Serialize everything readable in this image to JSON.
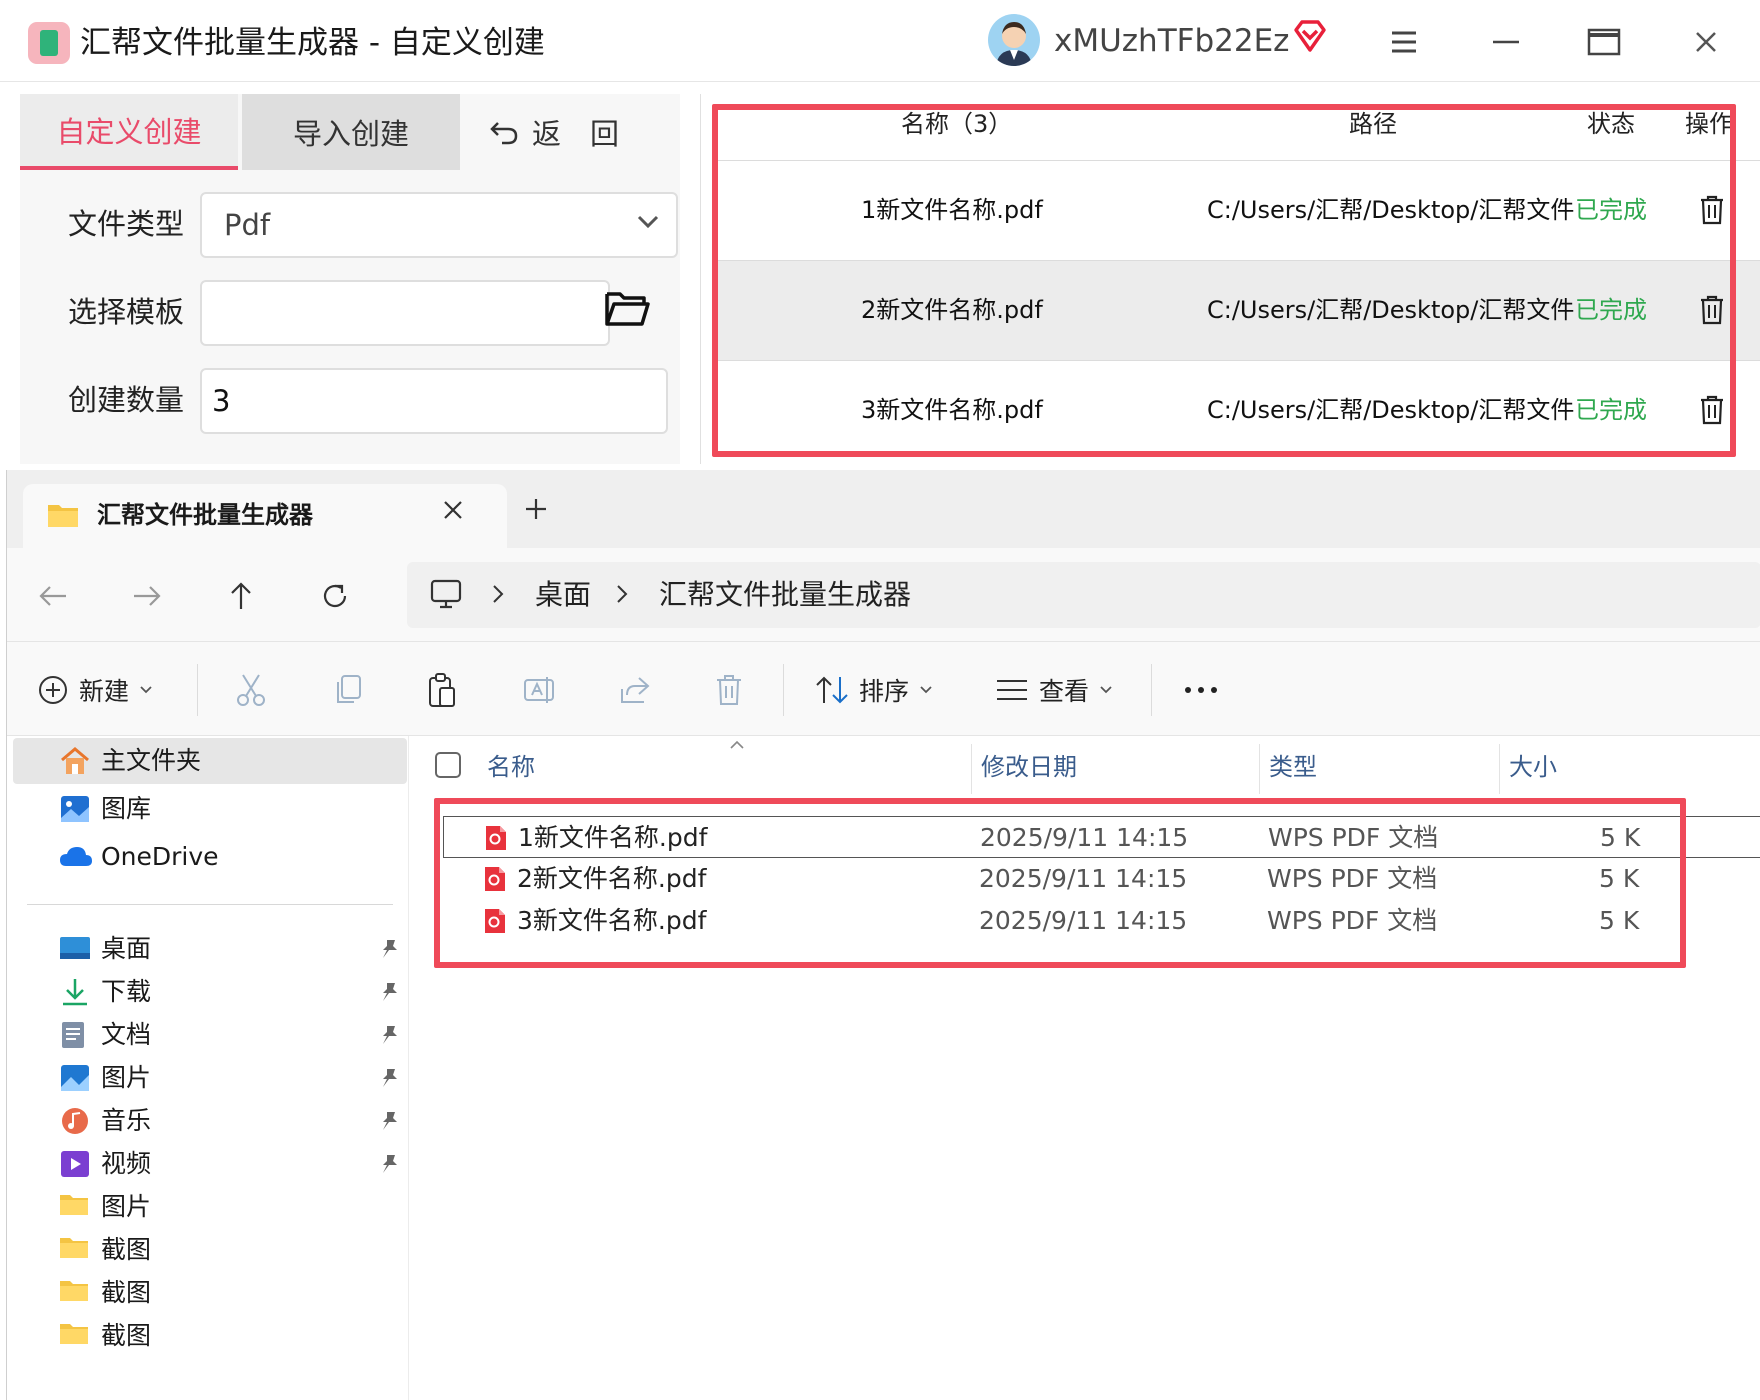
{
  "app": {
    "title": "汇帮文件批量生成器 - 自定义创建",
    "username": "xMUzhTFb22Ez"
  },
  "form": {
    "tabs": [
      "自定义创建",
      "导入创建"
    ],
    "back_label": "返　回",
    "file_type_label": "文件类型",
    "file_type_value": "Pdf",
    "template_label": "选择模板",
    "template_value": "",
    "count_label": "创建数量",
    "count_value": "3"
  },
  "results": {
    "headers": {
      "name": "名称（3）",
      "path": "路径",
      "status": "状态",
      "action": "操作"
    },
    "rows": [
      {
        "name": "1新文件名称.pdf",
        "path": "C:/Users/汇帮/Desktop/汇帮文件",
        "status": "已完成"
      },
      {
        "name": "2新文件名称.pdf",
        "path": "C:/Users/汇帮/Desktop/汇帮文件",
        "status": "已完成"
      },
      {
        "name": "3新文件名称.pdf",
        "path": "C:/Users/汇帮/Desktop/汇帮文件",
        "status": "已完成"
      }
    ]
  },
  "explorer": {
    "tab_title": "汇帮文件批量生成器",
    "breadcrumb": [
      "桌面",
      "汇帮文件批量生成器"
    ],
    "toolbar": {
      "new": "新建",
      "sort": "排序",
      "view": "查看"
    },
    "sidebar": {
      "top": [
        "主文件夹",
        "图库",
        "OneDrive"
      ],
      "pinned": [
        "桌面",
        "下载",
        "文档",
        "图片",
        "音乐",
        "视频"
      ],
      "folders": [
        "图片",
        "截图",
        "截图",
        "截图"
      ]
    },
    "columns": {
      "name": "名称",
      "modified": "修改日期",
      "type": "类型",
      "size": "大小"
    },
    "files": [
      {
        "name": "1新文件名称.pdf",
        "modified": "2025/9/11 14:15",
        "type": "WPS PDF 文档",
        "size": "5 K"
      },
      {
        "name": "2新文件名称.pdf",
        "modified": "2025/9/11 14:15",
        "type": "WPS PDF 文档",
        "size": "5 K"
      },
      {
        "name": "3新文件名称.pdf",
        "modified": "2025/9/11 14:15",
        "type": "WPS PDF 文档",
        "size": "5 K"
      }
    ]
  },
  "colors": {
    "accent": "#e94b6a",
    "highlight": "#ef4a59",
    "success": "#2fa84f"
  }
}
